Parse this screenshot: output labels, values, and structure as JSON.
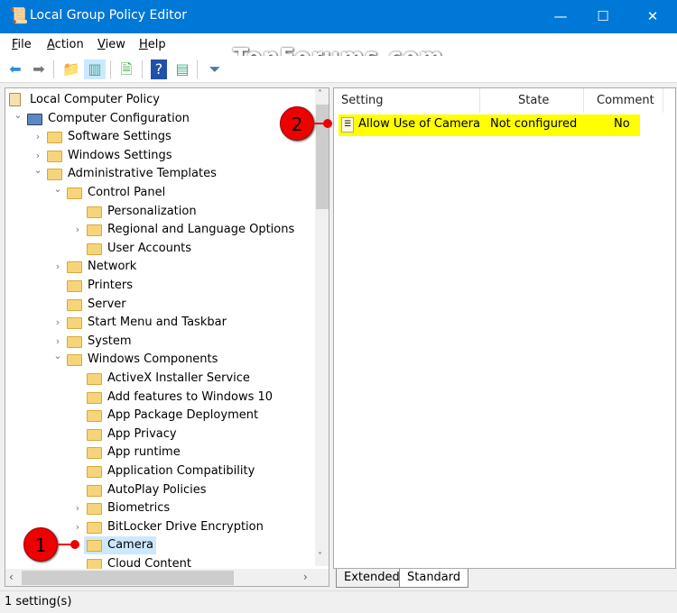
{
  "window": {
    "title": "Local Group Policy Editor",
    "minimize": "—",
    "maximize": "☐",
    "close": "✕"
  },
  "menu": [
    {
      "first": "F",
      "rest": "ile"
    },
    {
      "first": "A",
      "rest": "ction"
    },
    {
      "first": "V",
      "rest": "iew"
    },
    {
      "first": "H",
      "rest": "elp"
    }
  ],
  "watermark": "TenForums.com",
  "toolbar": [
    "back-icon",
    "forward-icon",
    "up-folder-icon",
    "show-hide-tree-icon",
    "export-list-icon",
    "help-icon",
    "properties-pane-icon",
    "filter-icon"
  ],
  "tree": [
    {
      "label": "Local Computer Policy",
      "depth": 0,
      "exp": "",
      "icon": "policy"
    },
    {
      "label": "Computer Configuration",
      "depth": 1,
      "exp": "open",
      "icon": "computer"
    },
    {
      "label": "Software Settings",
      "depth": 2,
      "exp": "closed"
    },
    {
      "label": "Windows Settings",
      "depth": 2,
      "exp": "closed"
    },
    {
      "label": "Administrative Templates",
      "depth": 2,
      "exp": "open"
    },
    {
      "label": "Control Panel",
      "depth": 3,
      "exp": "open"
    },
    {
      "label": "Personalization",
      "depth": 4,
      "exp": ""
    },
    {
      "label": "Regional and Language Options",
      "depth": 4,
      "exp": "closed"
    },
    {
      "label": "User Accounts",
      "depth": 4,
      "exp": ""
    },
    {
      "label": "Network",
      "depth": 3,
      "exp": "closed"
    },
    {
      "label": "Printers",
      "depth": 3,
      "exp": ""
    },
    {
      "label": "Server",
      "depth": 3,
      "exp": ""
    },
    {
      "label": "Start Menu and Taskbar",
      "depth": 3,
      "exp": "closed"
    },
    {
      "label": "System",
      "depth": 3,
      "exp": "closed"
    },
    {
      "label": "Windows Components",
      "depth": 3,
      "exp": "open"
    },
    {
      "label": "ActiveX Installer Service",
      "depth": 4,
      "exp": ""
    },
    {
      "label": "Add features to Windows 10",
      "depth": 4,
      "exp": ""
    },
    {
      "label": "App Package Deployment",
      "depth": 4,
      "exp": ""
    },
    {
      "label": "App Privacy",
      "depth": 4,
      "exp": ""
    },
    {
      "label": "App runtime",
      "depth": 4,
      "exp": ""
    },
    {
      "label": "Application Compatibility",
      "depth": 4,
      "exp": ""
    },
    {
      "label": "AutoPlay Policies",
      "depth": 4,
      "exp": ""
    },
    {
      "label": "Biometrics",
      "depth": 4,
      "exp": "closed"
    },
    {
      "label": "BitLocker Drive Encryption",
      "depth": 4,
      "exp": "closed"
    },
    {
      "label": "Camera",
      "depth": 4,
      "exp": "",
      "selected": true
    },
    {
      "label": "Cloud Content",
      "depth": 4,
      "exp": ""
    }
  ],
  "list": {
    "columns": [
      "Setting",
      "State",
      "Comment"
    ],
    "rows": [
      {
        "setting": "Allow Use of Camera",
        "state": "Not configured",
        "comment": "No"
      }
    ]
  },
  "tabs": [
    "Extended",
    "Standard"
  ],
  "status": "1 setting(s)",
  "callouts": [
    "1",
    "2"
  ],
  "colors": {
    "titlebar": "#0078d7",
    "highlight": "#ffff00",
    "callout": "#ee0000",
    "selection": "#cce8ff"
  }
}
